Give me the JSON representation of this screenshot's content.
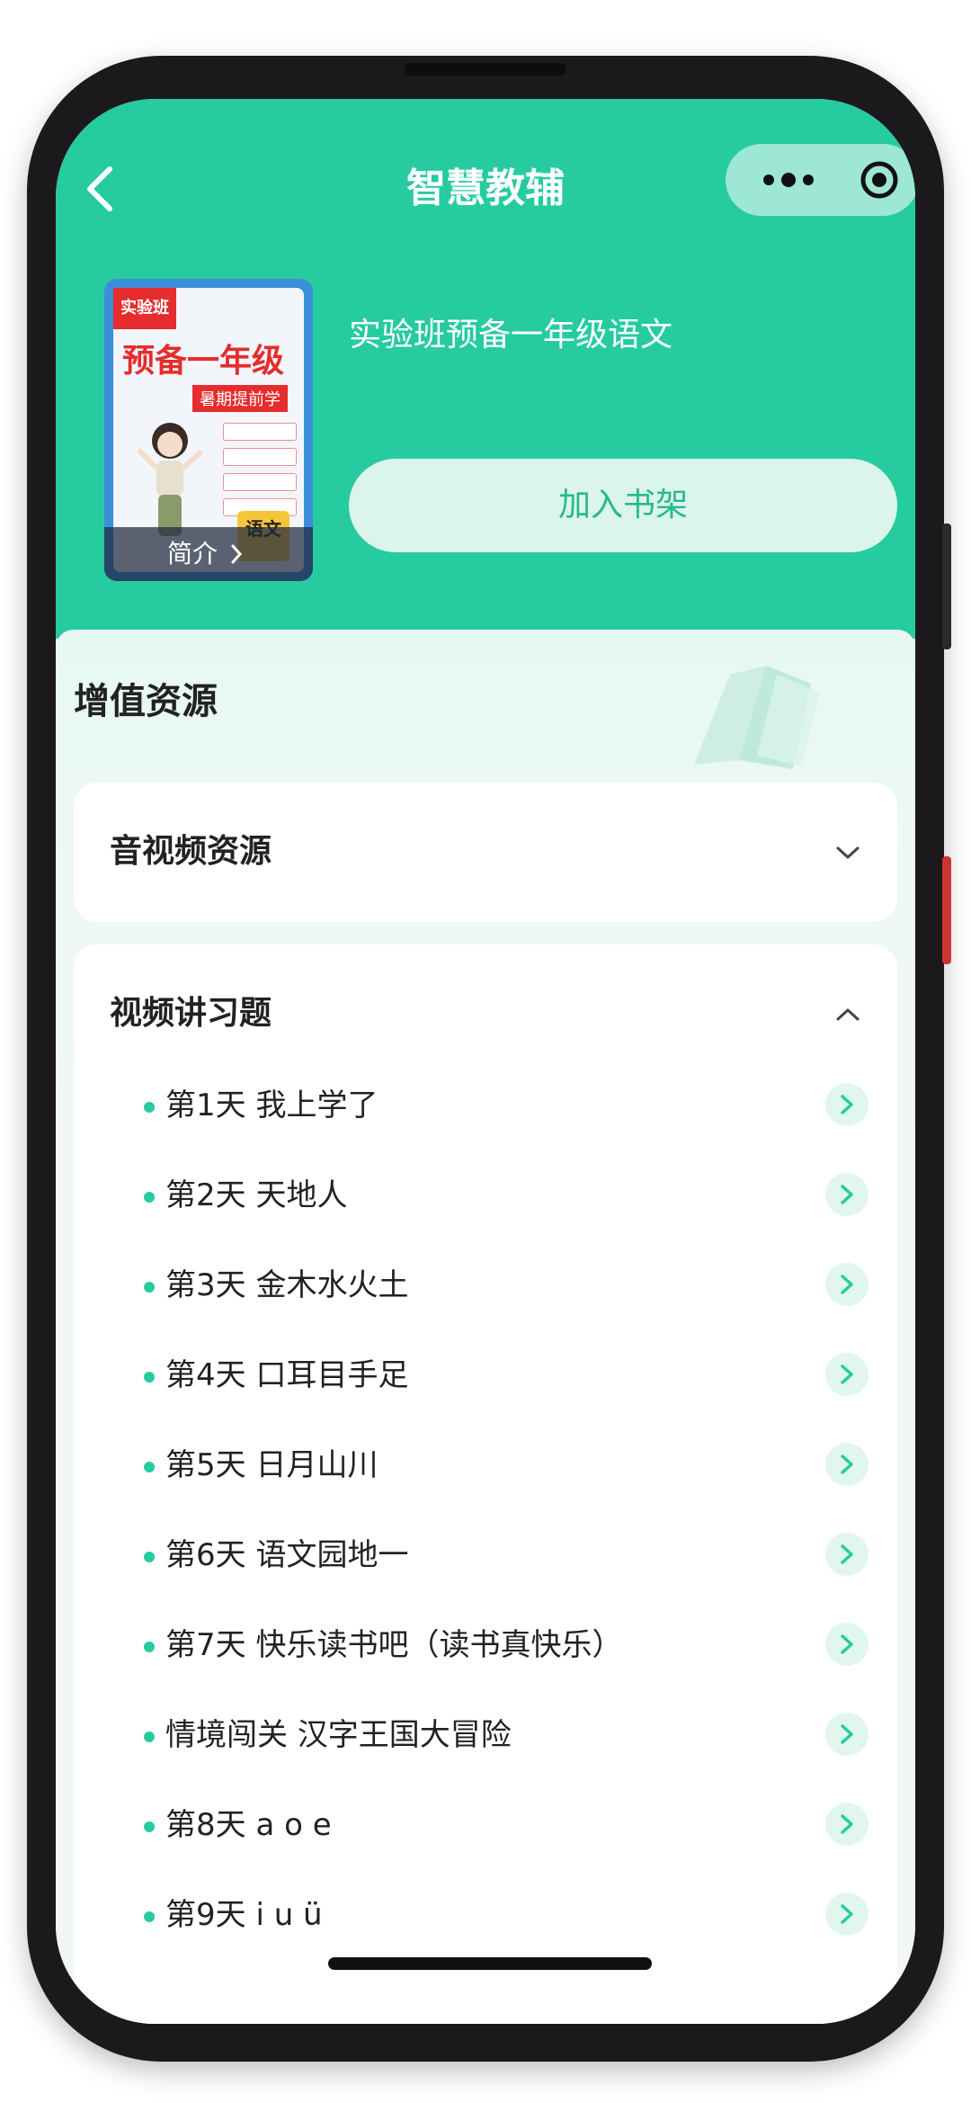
{
  "nav": {
    "title": "智慧教辅",
    "back_icon": "chevron-left-icon",
    "more_icon": "more-dots-icon",
    "target_icon": "target-icon"
  },
  "book": {
    "title": "实验班预备一年级语文",
    "cover": {
      "ribbon": "实验班",
      "big_title": "预备一年级",
      "subtitle": "暑期提前学",
      "corner": "语文",
      "intro_label": "简介"
    },
    "shelf_button": "加入书架"
  },
  "resources": {
    "section_title": "增值资源",
    "audio_video": {
      "title": "音视频资源",
      "expanded": false
    },
    "video_lessons": {
      "title": "视频讲习题",
      "expanded": true,
      "items": [
        "第1天  我上学了",
        "第2天  天地人",
        "第3天  金木水火土",
        "第4天  口耳目手足",
        "第5天  日月山川",
        "第6天  语文园地一",
        "第7天  快乐读书吧（读书真快乐）",
        "情境闯关  汉字王国大冒险",
        "第8天  a o e",
        "第9天  i u ü"
      ]
    }
  },
  "colors": {
    "brand_green": "#27cba0",
    "button_bg": "#dcf5ec",
    "button_text": "#27b98f"
  }
}
